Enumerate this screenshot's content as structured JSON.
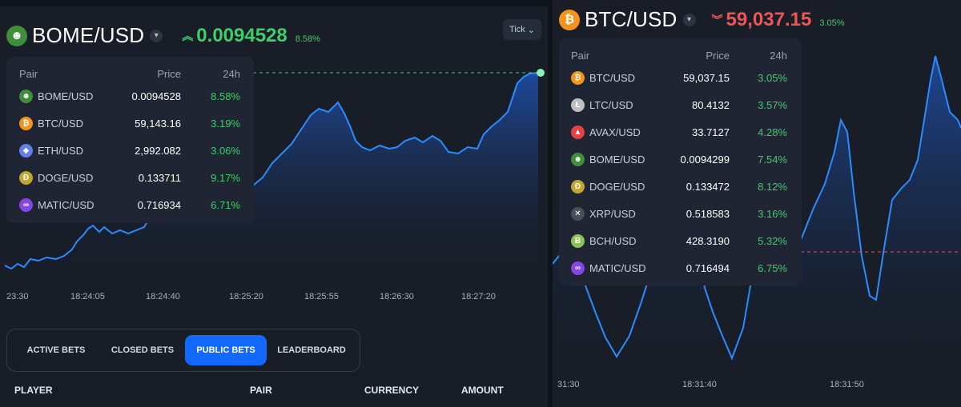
{
  "left": {
    "pair": "BOME/USD",
    "price": "0.0094528",
    "change": "8.58%",
    "tick_label": "Tick",
    "table_headers": {
      "pair": "Pair",
      "price": "Price",
      "change": "24h"
    },
    "rows": [
      {
        "pair": "BOME/USD",
        "price": "0.0094528",
        "change": "8.58%",
        "icon": "bome-icon",
        "color": "#3f8f3a",
        "glyph": "☻"
      },
      {
        "pair": "BTC/USD",
        "price": "59,143.16",
        "change": "3.19%",
        "icon": "btc-icon",
        "color": "#f7931a",
        "glyph": "₿"
      },
      {
        "pair": "ETH/USD",
        "price": "2,992.082",
        "change": "3.06%",
        "icon": "eth-icon",
        "color": "#627eea",
        "glyph": "◆"
      },
      {
        "pair": "DOGE/USD",
        "price": "0.133711",
        "change": "9.17%",
        "icon": "doge-icon",
        "color": "#c2a633",
        "glyph": "Ð"
      },
      {
        "pair": "MATIC/USD",
        "price": "0.716934",
        "change": "6.71%",
        "icon": "matic-icon",
        "color": "#8247e5",
        "glyph": "∞"
      }
    ],
    "times": [
      "23:30",
      "18:24:05",
      "18:24:40",
      "18:25:20",
      "18:25:55",
      "18:26:30",
      "18:27:20"
    ],
    "tabs": [
      "ACTIVE BETS",
      "CLOSED BETS",
      "PUBLIC BETS",
      "LEADERBOARD"
    ],
    "active_tab": "PUBLIC BETS",
    "columns": [
      "PLAYER",
      "PAIR",
      "CURRENCY",
      "AMOUNT"
    ]
  },
  "right": {
    "pair": "BTC/USD",
    "price": "59,037.15",
    "change": "3.05%",
    "table_headers": {
      "pair": "Pair",
      "price": "Price",
      "change": "24h"
    },
    "rows": [
      {
        "pair": "BTC/USD",
        "price": "59,037.15",
        "change": "3.05%",
        "icon": "btc-icon",
        "color": "#f7931a",
        "glyph": "₿"
      },
      {
        "pair": "LTC/USD",
        "price": "80.4132",
        "change": "3.57%",
        "icon": "ltc-icon",
        "color": "#bfbfbf",
        "glyph": "Ł"
      },
      {
        "pair": "AVAX/USD",
        "price": "33.7127",
        "change": "4.28%",
        "icon": "avax-icon",
        "color": "#e84142",
        "glyph": "▲"
      },
      {
        "pair": "BOME/USD",
        "price": "0.0094299",
        "change": "7.54%",
        "icon": "bome-icon",
        "color": "#3f8f3a",
        "glyph": "☻"
      },
      {
        "pair": "DOGE/USD",
        "price": "0.133472",
        "change": "8.12%",
        "icon": "doge-icon",
        "color": "#c2a633",
        "glyph": "Ð"
      },
      {
        "pair": "XRP/USD",
        "price": "0.518583",
        "change": "3.16%",
        "icon": "xrp-icon",
        "color": "#4a4f57",
        "glyph": "✕"
      },
      {
        "pair": "BCH/USD",
        "price": "428.3190",
        "change": "5.32%",
        "icon": "bch-icon",
        "color": "#8dc351",
        "glyph": "Ƀ"
      },
      {
        "pair": "MATIC/USD",
        "price": "0.716494",
        "change": "6.75%",
        "icon": "matic-icon",
        "color": "#8247e5",
        "glyph": "∞"
      }
    ],
    "times": [
      "31:30",
      "18:31:40",
      "18:31:50"
    ]
  },
  "colors": {
    "up": "#3ccf6a",
    "down": "#f05454",
    "accent": "#1368ff",
    "line": "#2a8cff",
    "btc": "#f7931a"
  }
}
